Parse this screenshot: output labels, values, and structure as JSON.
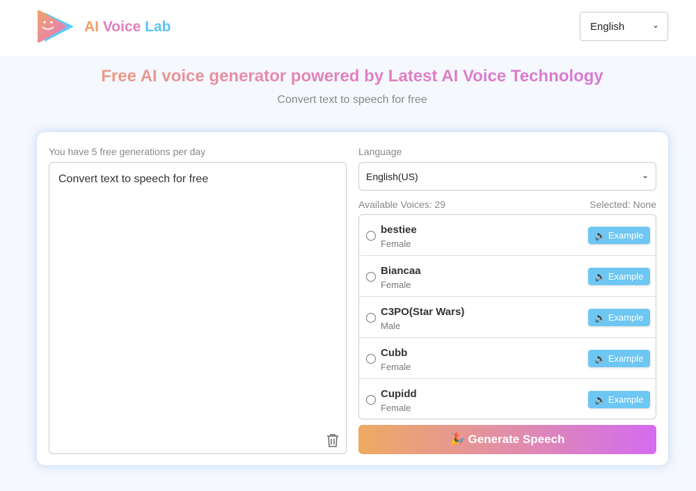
{
  "header": {
    "brand": {
      "ai": "AI",
      "voice": "Voice",
      "lab": "Lab"
    },
    "language": "English"
  },
  "hero": {
    "title": "Free AI voice generator powered by Latest AI Voice Technology",
    "subtitle": "Convert text to speech for free"
  },
  "editor": {
    "quota": "You have 5 free generations per day",
    "text": "Convert text to speech for free"
  },
  "settings": {
    "language_label": "Language",
    "language": "English(US)",
    "available": "Available Voices: 29",
    "selected": "Selected: None",
    "voices": [
      {
        "name": "bestiee",
        "gender": "Female"
      },
      {
        "name": "Biancaa",
        "gender": "Female"
      },
      {
        "name": "C3PO(Star Wars)",
        "gender": "Male"
      },
      {
        "name": "Cubb",
        "gender": "Female"
      },
      {
        "name": "Cupidd",
        "gender": "Female"
      }
    ],
    "example_label": "Example",
    "generate_label": "🎉 Generate Speech"
  },
  "colors": {
    "example": "#6ec6f2",
    "gradient_start": "#eeaa62",
    "gradient_end": "#d36bf0"
  }
}
